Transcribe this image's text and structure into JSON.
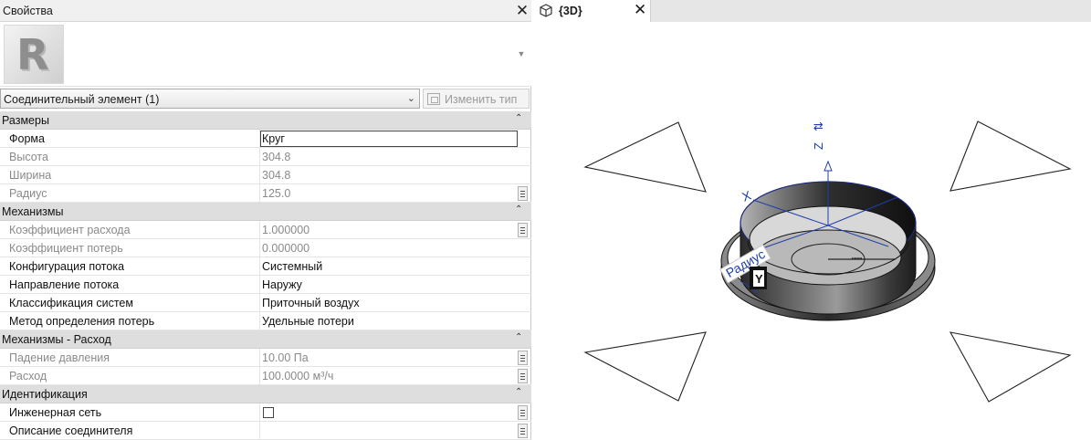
{
  "properties": {
    "title": "Свойства",
    "logo_letter": "R",
    "type_selector": "Соединительный элемент (1)",
    "edit_type": "Изменить тип",
    "groups": {
      "razmery": "Размеры",
      "mehanizmy": "Механизмы",
      "rashod": "Механизмы - Расход",
      "ident": "Идентификация"
    },
    "rows": {
      "forma": {
        "name": "Форма",
        "value": "Круг"
      },
      "vysota": {
        "name": "Высота",
        "value": "304.8"
      },
      "shirina": {
        "name": "Ширина",
        "value": "304.8"
      },
      "radius": {
        "name": "Радиус",
        "value": "125.0"
      },
      "koef_rashoda": {
        "name": "Коэффициент расхода",
        "value": "1.000000"
      },
      "koef_poter": {
        "name": "Коэффициент потерь",
        "value": "0.000000"
      },
      "konfig": {
        "name": "Конфигурация потока",
        "value": "Системный"
      },
      "napravl": {
        "name": "Направление потока",
        "value": "Наружу"
      },
      "klassif": {
        "name": "Классификация систем",
        "value": "Приточный воздух"
      },
      "metod": {
        "name": "Метод определения потерь",
        "value": "Удельные потери"
      },
      "padenie": {
        "name": "Падение давления",
        "value": "10.00 Па"
      },
      "rashod": {
        "name": "Расход",
        "value": "100.0000 м³/ч"
      },
      "inzh_set": {
        "name": "Инженерная сеть",
        "checked": false
      },
      "opisanie": {
        "name": "Описание соединителя",
        "value": ""
      }
    }
  },
  "view": {
    "tab_label": "{3D}",
    "labels": {
      "radius": "Радиус",
      "z_axis": "Z",
      "x_axis": "X",
      "y_axis": "Y",
      "arrow_symbol": "⇅"
    }
  }
}
